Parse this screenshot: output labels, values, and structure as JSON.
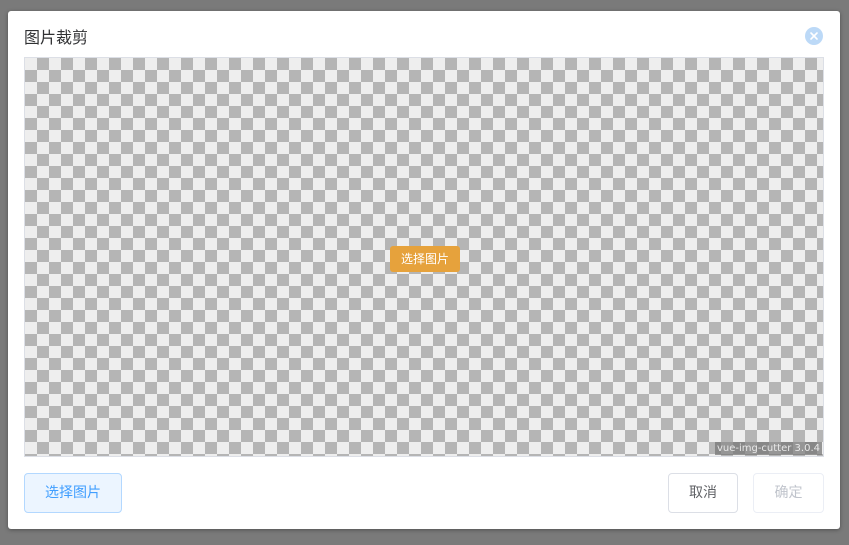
{
  "dialog": {
    "title": "图片裁剪",
    "close_icon": "close-circle-icon"
  },
  "cutter": {
    "select_label": "选择图片",
    "watermark": "vue-img-cutter 3.0.4"
  },
  "footer": {
    "select_label": "选择图片",
    "cancel_label": "取消",
    "confirm_label": "确定"
  },
  "colors": {
    "overlay": "#7a7a7a",
    "accent_warning": "#e6a23c",
    "accent_primary": "#409eff",
    "close_icon_bg": "#bcd9f7"
  }
}
